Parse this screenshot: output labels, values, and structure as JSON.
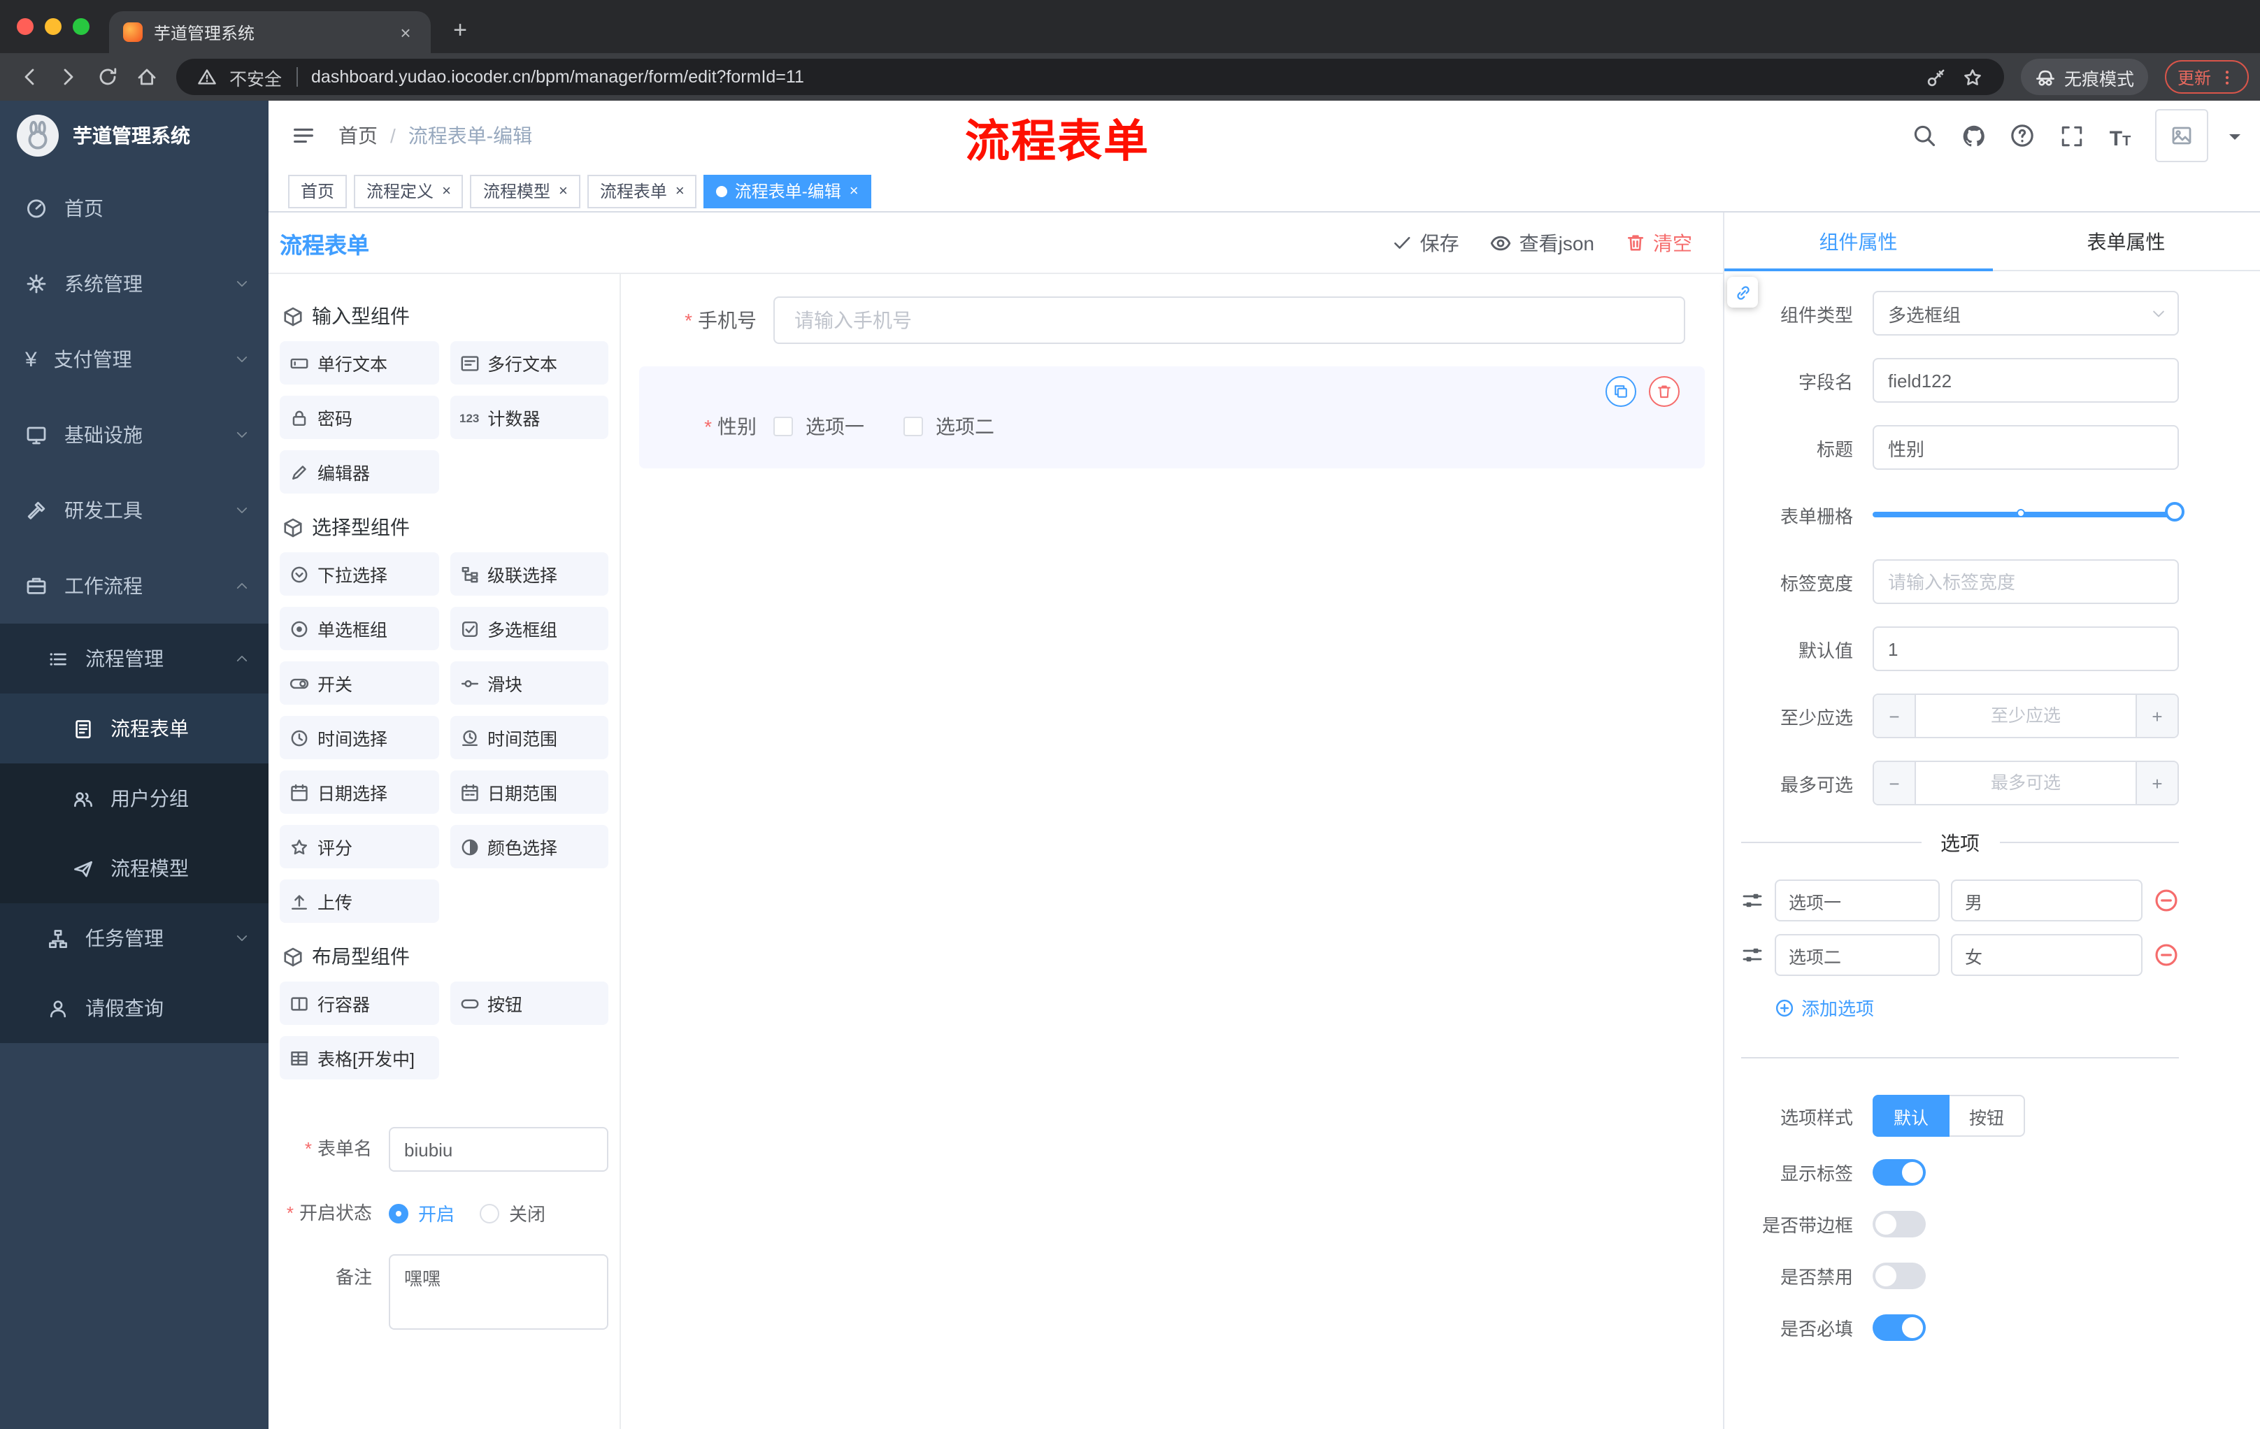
{
  "colors": {
    "accent": "#409eff",
    "danger": "#f56c6c",
    "annotation": "#fe1000",
    "sidebar_bg": "#304156",
    "sidebar_submenu_bg": "#1f2d3d"
  },
  "browser": {
    "tab_title": "芋道管理系统",
    "security_label": "不安全",
    "url": "dashboard.yudao.iocoder.cn/bpm/manager/form/edit?formId=11",
    "incognito_label": "无痕模式",
    "update_label": "更新",
    "nav_icons": [
      "back-icon",
      "forward-icon",
      "reload-icon",
      "home-icon"
    ],
    "omnibox_icons": [
      "warning-icon",
      "key-icon",
      "star-icon"
    ],
    "right_icons": [
      "incognito-icon",
      "more-menu-icon"
    ]
  },
  "sidebar": {
    "logo_title": "芋道管理系统",
    "items": [
      {
        "label": "首页",
        "icon": "dashboard-icon"
      },
      {
        "label": "系统管理",
        "icon": "gear-icon"
      },
      {
        "label": "支付管理",
        "icon": "yen-icon"
      },
      {
        "label": "基础设施",
        "icon": "monitor-icon"
      },
      {
        "label": "研发工具",
        "icon": "tool-icon"
      },
      {
        "label": "工作流程",
        "icon": "briefcase-icon"
      }
    ],
    "submenu": {
      "process_mgmt": {
        "label": "流程管理",
        "icon": "list-icon"
      },
      "children": [
        {
          "label": "流程表单",
          "icon": "document-icon",
          "active": true
        },
        {
          "label": "用户分组",
          "icon": "users-icon"
        },
        {
          "label": "流程模型",
          "icon": "paper-plane-icon"
        }
      ],
      "task_mgmt": {
        "label": "任务管理",
        "icon": "tree-icon"
      },
      "leave_query": {
        "label": "请假查询",
        "icon": "person-icon"
      }
    }
  },
  "header": {
    "breadcrumb": {
      "home": "首页",
      "separator": "/",
      "current": "流程表单-编辑"
    },
    "annotation": "流程表单",
    "action_icons": [
      "search-icon",
      "github-icon",
      "help-icon",
      "fullscreen-icon",
      "font-size-icon",
      "avatar",
      "caret-down-icon"
    ]
  },
  "tags": [
    {
      "label": "首页"
    },
    {
      "label": "流程定义"
    },
    {
      "label": "流程模型"
    },
    {
      "label": "流程表单"
    },
    {
      "label": "流程表单-编辑"
    }
  ],
  "designer": {
    "title": "流程表单",
    "toolbar": {
      "save": "保存",
      "view_json": "查看json",
      "clear": "清空"
    },
    "palette": {
      "sections": [
        {
          "title": "输入型组件",
          "items": [
            {
              "label": "单行文本",
              "icon": "text-field-icon"
            },
            {
              "label": "多行文本",
              "icon": "textarea-icon"
            },
            {
              "label": "密码",
              "icon": "lock-icon"
            },
            {
              "label": "计数器",
              "icon": "counter-icon"
            },
            {
              "label": "编辑器",
              "icon": "editor-icon"
            }
          ]
        },
        {
          "title": "选择型组件",
          "items": [
            {
              "label": "下拉选择",
              "icon": "select-icon"
            },
            {
              "label": "级联选择",
              "icon": "cascader-icon"
            },
            {
              "label": "单选框组",
              "icon": "radio-icon"
            },
            {
              "label": "多选框组",
              "icon": "checkbox-icon"
            },
            {
              "label": "开关",
              "icon": "switch-icon"
            },
            {
              "label": "滑块",
              "icon": "slider-icon"
            },
            {
              "label": "时间选择",
              "icon": "time-icon"
            },
            {
              "label": "时间范围",
              "icon": "time-range-icon"
            },
            {
              "label": "日期选择",
              "icon": "date-icon"
            },
            {
              "label": "日期范围",
              "icon": "date-range-icon"
            },
            {
              "label": "评分",
              "icon": "star-icon"
            },
            {
              "label": "颜色选择",
              "icon": "color-icon"
            },
            {
              "label": "上传",
              "icon": "upload-icon"
            }
          ]
        },
        {
          "title": "布局型组件",
          "items": [
            {
              "label": "行容器",
              "icon": "row-icon"
            },
            {
              "label": "按钮",
              "icon": "button-icon"
            },
            {
              "label": "表格[开发中]",
              "icon": "table-icon"
            }
          ]
        }
      ]
    },
    "meta": {
      "form_name": {
        "label": "表单名",
        "value": "biubiu"
      },
      "open_status": {
        "label": "开启状态",
        "options": [
          {
            "label": "开启",
            "selected": true
          },
          {
            "label": "关闭",
            "selected": false
          }
        ]
      },
      "remark": {
        "label": "备注",
        "value": "嘿嘿"
      }
    },
    "canvas": {
      "phone": {
        "label": "手机号",
        "placeholder": "请输入手机号"
      },
      "gender": {
        "label": "性别",
        "options": [
          {
            "label": "选项一"
          },
          {
            "label": "选项二"
          }
        ],
        "action_icons": [
          "copy-icon",
          "delete-icon"
        ]
      }
    }
  },
  "props": {
    "tabs": [
      {
        "label": "组件属性"
      },
      {
        "label": "表单属性"
      }
    ],
    "component_type": {
      "label": "组件类型",
      "value": "多选框组"
    },
    "field_name": {
      "label": "字段名",
      "value": "field122"
    },
    "title": {
      "label": "标题",
      "value": "性别"
    },
    "grid": {
      "label": "表单栅格"
    },
    "label_width": {
      "label": "标签宽度",
      "placeholder": "请输入标签宽度"
    },
    "default_value": {
      "label": "默认值",
      "value": "1"
    },
    "min_select": {
      "label": "至少应选",
      "placeholder": "至少应选"
    },
    "max_select": {
      "label": "最多可选",
      "placeholder": "最多可选"
    },
    "options_title": "选项",
    "options": [
      {
        "label": "选项一",
        "value": "男"
      },
      {
        "label": "选项二",
        "value": "女"
      }
    ],
    "add_option": "添加选项",
    "option_style": {
      "label": "选项样式",
      "buttons": [
        {
          "label": "默认",
          "active": true
        },
        {
          "label": "按钮",
          "active": false
        }
      ]
    },
    "switches": [
      {
        "label": "显示标签",
        "on": true
      },
      {
        "label": "是否带边框",
        "on": false
      },
      {
        "label": "是否禁用",
        "on": false
      },
      {
        "label": "是否必填",
        "on": true
      }
    ]
  }
}
